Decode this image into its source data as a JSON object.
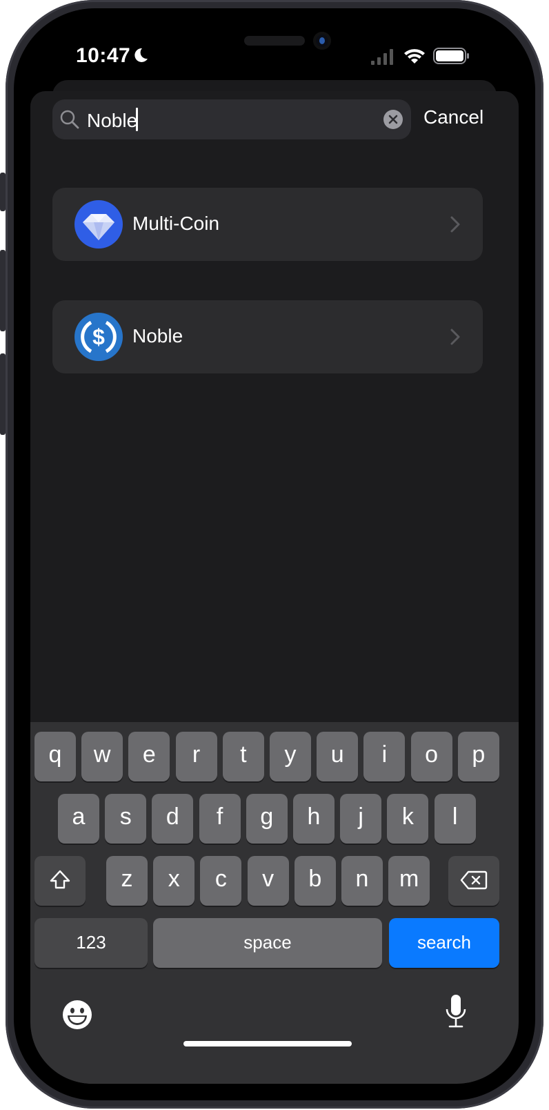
{
  "status_bar": {
    "time": "10:47",
    "focus_icon": "moon-icon",
    "signal_icon": "cellular-signal-icon",
    "wifi_icon": "wifi-icon",
    "battery_icon": "battery-icon"
  },
  "search": {
    "value": "Noble",
    "placeholder": "",
    "clear_icon": "clear-circle-icon",
    "cancel_label": "Cancel"
  },
  "results": [
    {
      "label": "Multi-Coin",
      "icon": "diamond-icon",
      "icon_color": "#2f5ee6"
    },
    {
      "label": "Noble",
      "icon": "usdc-dollar-icon",
      "icon_color": "#2775ca"
    }
  ],
  "keyboard": {
    "row1": [
      "q",
      "w",
      "e",
      "r",
      "t",
      "y",
      "u",
      "i",
      "o",
      "p"
    ],
    "row2": [
      "a",
      "s",
      "d",
      "f",
      "g",
      "h",
      "j",
      "k",
      "l"
    ],
    "row3": [
      "z",
      "x",
      "c",
      "v",
      "b",
      "n",
      "m"
    ],
    "numbers_label": "123",
    "space_label": "space",
    "return_label": "search",
    "return_color": "#0a7aff"
  }
}
